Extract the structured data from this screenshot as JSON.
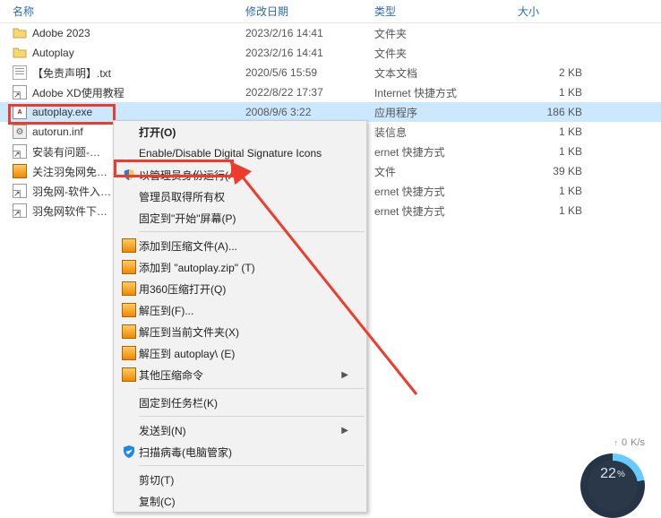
{
  "headers": {
    "name": "名称",
    "date": "修改日期",
    "type": "类型",
    "size": "大小"
  },
  "rows": [
    {
      "icon": "folder",
      "name": "Adobe 2023",
      "date": "2023/2/16 14:41",
      "type": "文件夹",
      "size": ""
    },
    {
      "icon": "folder",
      "name": "Autoplay",
      "date": "2023/2/16 14:41",
      "type": "文件夹",
      "size": ""
    },
    {
      "icon": "txt",
      "name": "【免责声明】.txt",
      "date": "2020/5/6 15:59",
      "type": "文本文档",
      "size": "2 KB"
    },
    {
      "icon": "link",
      "name": "Adobe XD使用教程",
      "date": "2022/8/22 17:37",
      "type": "Internet 快捷方式",
      "size": "1 KB"
    },
    {
      "icon": "adobe",
      "name": "autoplay.exe",
      "date": "2008/9/6 3:22",
      "type": "应用程序",
      "size": "186 KB",
      "selected": true
    },
    {
      "icon": "inf",
      "name": "autorun.inf",
      "date": "",
      "type": "装信息",
      "size": "1 KB"
    },
    {
      "icon": "link",
      "name": "安装有问题-…",
      "date": "",
      "type": "ernet 快捷方式",
      "size": "1 KB"
    },
    {
      "icon": "zip",
      "name": "关注羽兔网免…",
      "date": "",
      "type": "文件",
      "size": "39 KB"
    },
    {
      "icon": "link",
      "name": "羽兔网-软件入…",
      "date": "",
      "type": "ernet 快捷方式",
      "size": "1 KB"
    },
    {
      "icon": "link",
      "name": "羽兔网软件下…",
      "date": "",
      "type": "ernet 快捷方式",
      "size": "1 KB"
    }
  ],
  "menu": [
    [
      {
        "icon": "",
        "label": "打开(O)",
        "bold": true
      },
      {
        "icon": "",
        "label": "Enable/Disable Digital Signature Icons"
      },
      {
        "icon": "shield",
        "label": "以管理员身份运行(A)"
      },
      {
        "icon": "",
        "label": "管理员取得所有权"
      },
      {
        "icon": "",
        "label": "固定到\"开始\"屏幕(P)"
      }
    ],
    [
      {
        "icon": "zip",
        "label": "添加到压缩文件(A)..."
      },
      {
        "icon": "zip",
        "label": "添加到 \"autoplay.zip\" (T)"
      },
      {
        "icon": "zip",
        "label": "用360压缩打开(Q)"
      },
      {
        "icon": "zip",
        "label": "解压到(F)..."
      },
      {
        "icon": "zip",
        "label": "解压到当前文件夹(X)"
      },
      {
        "icon": "zip",
        "label": "解压到 autoplay\\ (E)"
      },
      {
        "icon": "zip",
        "label": "其他压缩命令",
        "sub": true
      }
    ],
    [
      {
        "icon": "",
        "label": "固定到任务栏(K)"
      }
    ],
    [
      {
        "icon": "",
        "label": "发送到(N)",
        "sub": true
      },
      {
        "icon": "scan",
        "label": "扫描病毒(电脑管家)"
      }
    ],
    [
      {
        "icon": "",
        "label": "剪切(T)"
      },
      {
        "icon": "",
        "label": "复制(C)"
      }
    ]
  ],
  "gauge": {
    "value": "22",
    "pct": "%"
  },
  "speed": {
    "up": "↑",
    "val": "0",
    "unit": "K/s"
  }
}
